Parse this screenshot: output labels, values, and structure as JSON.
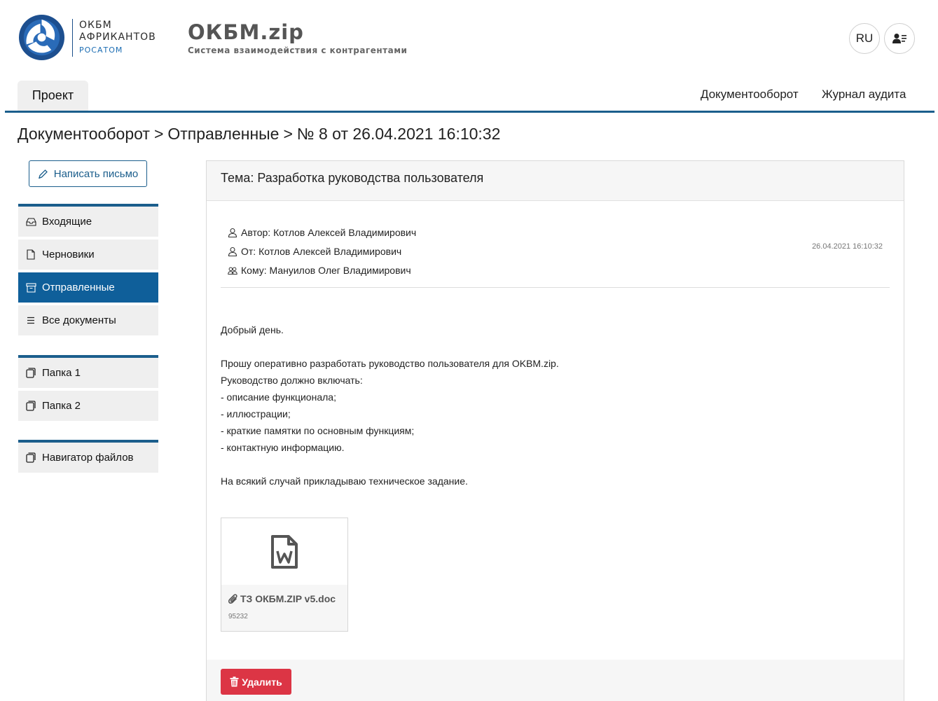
{
  "logo": {
    "line1": "ОКБМ",
    "line2": "АФРИКАНТОВ",
    "line3": "РОСАТОМ",
    "icon": "rosatom-logo-icon"
  },
  "brand": {
    "title": "ОКБМ.zip",
    "subtitle": "Система взаимодействия с контрагентами"
  },
  "header": {
    "lang": "RU",
    "user_icon": "user-card-icon"
  },
  "nav": {
    "project": "Проект",
    "docflow": "Документооборот",
    "audit": "Журнал аудита"
  },
  "breadcrumb": {
    "part1": "Документооборот",
    "sep1": ">",
    "part2": "Отправленные",
    "sep2": ">",
    "part3": "№ 8 от 26.04.2021 16:10:32"
  },
  "sidebar": {
    "compose": "Написать письмо",
    "mail": [
      {
        "label": "Входящие",
        "icon": "inbox-icon"
      },
      {
        "label": "Черновики",
        "icon": "file-icon"
      },
      {
        "label": "Отправленные",
        "icon": "archive-icon",
        "active": true
      },
      {
        "label": "Все документы",
        "icon": "list-icon"
      }
    ],
    "folders": [
      {
        "label": "Папка 1",
        "icon": "folder-icon"
      },
      {
        "label": "Папка 2",
        "icon": "folder-icon"
      }
    ],
    "files": [
      {
        "label": "Навигатор файлов",
        "icon": "folder-icon"
      }
    ]
  },
  "message": {
    "subject": "Тема: Разработка руководства пользователя",
    "author": "Автор: Котлов Алексей Владимирович",
    "from": "От: Котлов Алексей Владимирович",
    "to": "Кому: Мануилов Олег Владимирович",
    "date": "26.04.2021 16:10:32",
    "body": [
      "Добрый день.",
      "",
      "Прошу оперативно разработать руководство пользователя для OKBM.zip.",
      "Руководство должно включать:",
      "- описание функционала;",
      "- иллюстрации;",
      "- краткие памятки по основным функциям;",
      "- контактную информацию.",
      "",
      "На всякий случай прикладываю техническое задание."
    ],
    "attachment": {
      "name": "ТЗ ОКБМ.ZIP v5.doc",
      "size": "95232",
      "icon": "word-file-icon"
    },
    "delete": "Удалить"
  },
  "colors": {
    "accent": "#1b5e8c",
    "active": "#0f5f9a",
    "danger": "#dc3545"
  }
}
